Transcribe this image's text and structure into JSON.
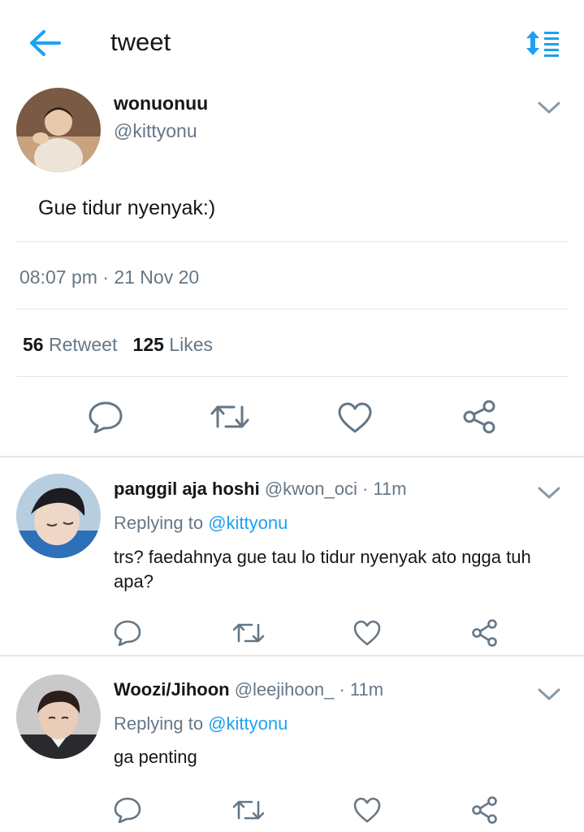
{
  "header": {
    "title": "tweet",
    "back_icon": "arrow-left-icon",
    "sort_icon": "sort-icon",
    "accent": "#1da1f2"
  },
  "main_tweet": {
    "display_name": "wonuonuu",
    "handle": "@kittyonu",
    "text": "Gue tidur nyenyak:)",
    "timestamp": "08:07 pm · 21 Nov 20",
    "retweet_count": "56",
    "retweet_label": "Retweet",
    "like_count": "125",
    "like_label": "Likes"
  },
  "replies": [
    {
      "display_name": "panggil aja hoshi",
      "meta": "@kwon_oci · 11m",
      "replying_prefix": "Replying to ",
      "replying_to": "@kittyonu",
      "text": "trs? faedahnya gue tau lo tidur nyenyak ato ngga tuh apa?"
    },
    {
      "display_name": "Woozi/Jihoon",
      "meta": "@leejihoon_ · 11m",
      "replying_prefix": "Replying to ",
      "replying_to": "@kittyonu",
      "text": "ga penting"
    }
  ],
  "colors": {
    "text": "#14171a",
    "secondary": "#657786",
    "divider": "#e1e8ed",
    "link": "#1da1f2"
  }
}
